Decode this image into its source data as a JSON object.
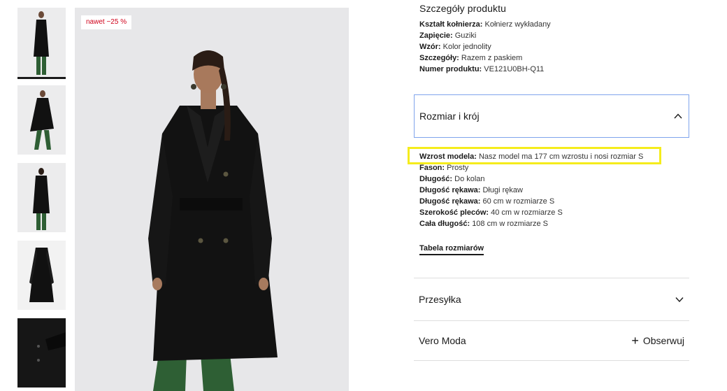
{
  "gallery": {
    "badge": "nawet −25 %",
    "thumbnail_count": 5
  },
  "product_details": {
    "heading": "Szczegóły produktu",
    "attributes": [
      {
        "label": "Kształt kołnierza:",
        "value": "Kołnierz wykładany"
      },
      {
        "label": "Zapięcie:",
        "value": "Guziki"
      },
      {
        "label": "Wzór:",
        "value": "Kolor jednolity"
      },
      {
        "label": "Szczegóły:",
        "value": "Razem z paskiem"
      },
      {
        "label": "Numer produktu:",
        "value": "VE121U0BH-Q11"
      }
    ]
  },
  "size_fit": {
    "title": "Rozmiar i krój",
    "expanded": true,
    "attributes": [
      {
        "label": "Wzrost modela:",
        "value": "Nasz model ma 177 cm wzrostu i nosi rozmiar S"
      },
      {
        "label": "Fason:",
        "value": "Prosty"
      },
      {
        "label": "Długość:",
        "value": "Do kolan"
      },
      {
        "label": "Długość rękawa:",
        "value": "Długi rękaw"
      },
      {
        "label": "Długość rękawa:",
        "value": "60 cm w rozmiarze S"
      },
      {
        "label": "Szerokość pleców:",
        "value": "40 cm w rozmiarze S"
      },
      {
        "label": "Cała długość:",
        "value": "108 cm w rozmiarze S"
      }
    ],
    "size_table_link": "Tabela rozmiarów"
  },
  "shipping": {
    "title": "Przesyłka"
  },
  "brand": {
    "name": "Vero Moda",
    "follow_label": "Obserwuj"
  },
  "colors": {
    "highlight": "#f5ec1c",
    "badge_text": "#d0021b",
    "focus_border": "#7fa4ec"
  }
}
